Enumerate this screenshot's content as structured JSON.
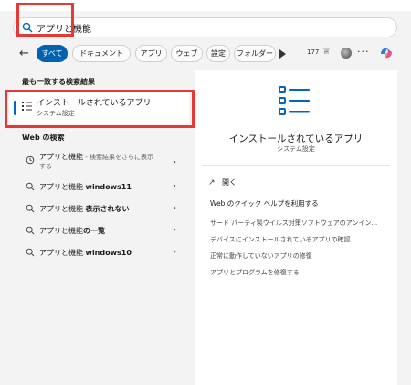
{
  "search": {
    "query": "アプリと機能"
  },
  "filters": {
    "tabs": [
      "すべて",
      "ドキュメント",
      "アプリ",
      "ウェブ",
      "設定",
      "フォルダー"
    ],
    "points": "177"
  },
  "left": {
    "best_match_title": "最も一致する検索結果",
    "best_match": {
      "title": "インストールされているアプリ",
      "subtitle": "システム設定"
    },
    "web_title": "Web の検索",
    "web_results": [
      {
        "main": "アプリと機能",
        "extra": " - 検索結果をさらに表示",
        "line2": "する",
        "icon": "history-icon"
      },
      {
        "main": "アプリと機能 ",
        "bold": "windows11",
        "icon": "search-icon"
      },
      {
        "main": "アプリと機能 ",
        "bold": "表示されない",
        "icon": "search-icon"
      },
      {
        "main": "アプリと機能",
        "bold": "の一覧",
        "icon": "search-icon"
      },
      {
        "main": "アプリと機能 ",
        "bold": "windows10",
        "icon": "search-icon"
      }
    ]
  },
  "right": {
    "title": "インストールされているアプリ",
    "subtitle": "システム設定",
    "open_label": "開く",
    "help_heading": "Web のクイック ヘルプを利用する",
    "help_links": [
      "サード パーティ製ウイルス対策ソフトウェアのアンイン...",
      "デバイスにインストールされているアプリの確認",
      "正常に動作していないアプリの修復",
      "アプリとプログラムを修復する"
    ]
  },
  "colors": {
    "accent": "#0063b1",
    "highlight": "#e53935"
  }
}
